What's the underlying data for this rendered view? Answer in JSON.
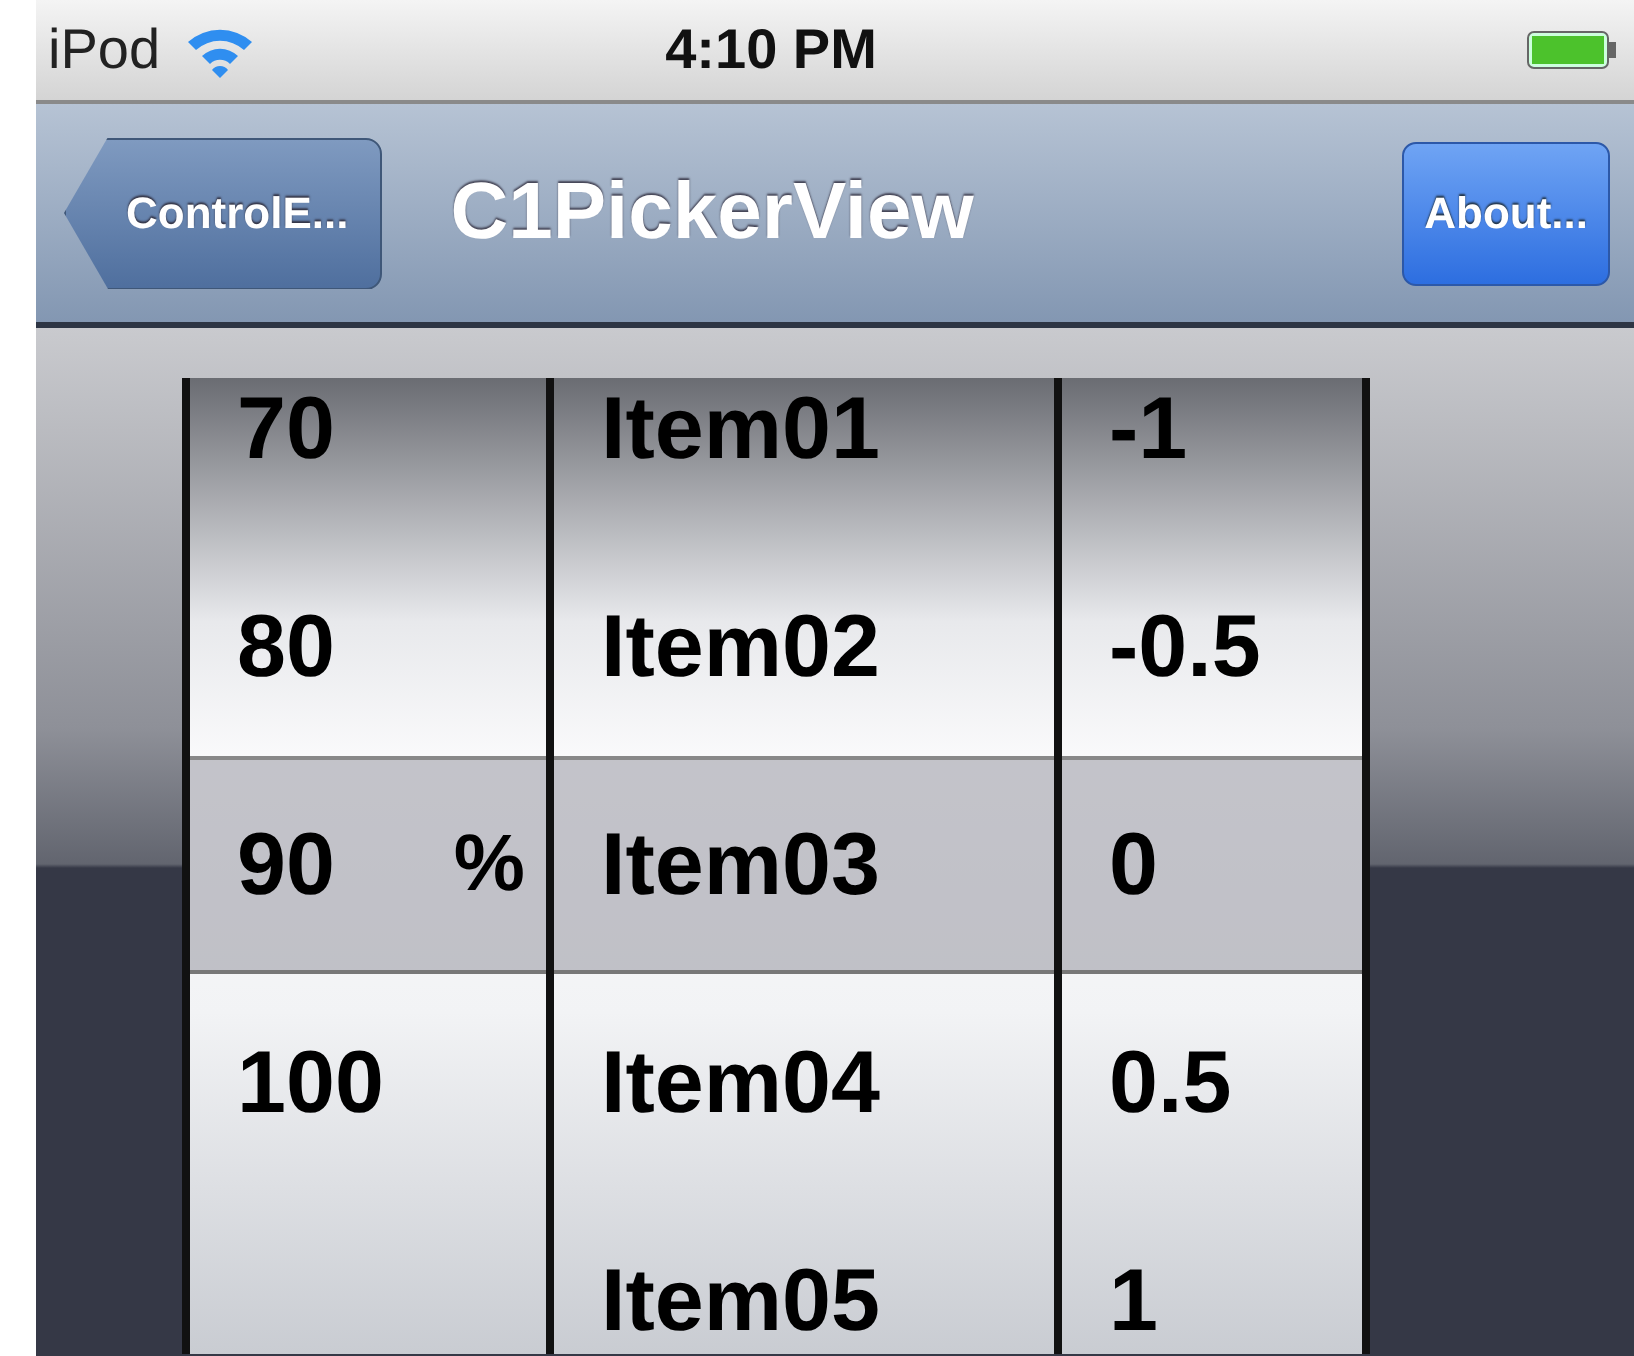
{
  "status_bar": {
    "carrier": "iPod",
    "time": "4:10 PM"
  },
  "nav_bar": {
    "back_button": "ControlE...",
    "title": "C1PickerView",
    "right_button": "About..."
  },
  "picker": {
    "columns": [
      {
        "unit": "%",
        "rows": [
          {
            "label": "70",
            "selected": false
          },
          {
            "label": "80",
            "selected": false
          },
          {
            "label": "90",
            "selected": true
          },
          {
            "label": "100",
            "selected": false
          }
        ]
      },
      {
        "rows": [
          {
            "label": "Item01",
            "selected": false
          },
          {
            "label": "Item02",
            "selected": false
          },
          {
            "label": "Item03",
            "selected": true
          },
          {
            "label": "Item04",
            "selected": false
          },
          {
            "label": "Item05",
            "selected": false
          }
        ]
      },
      {
        "rows": [
          {
            "label": "-1",
            "selected": false
          },
          {
            "label": "-0.5",
            "selected": false
          },
          {
            "label": "0",
            "selected": true
          },
          {
            "label": "0.5",
            "selected": false
          },
          {
            "label": "1",
            "selected": false
          }
        ]
      }
    ]
  }
}
